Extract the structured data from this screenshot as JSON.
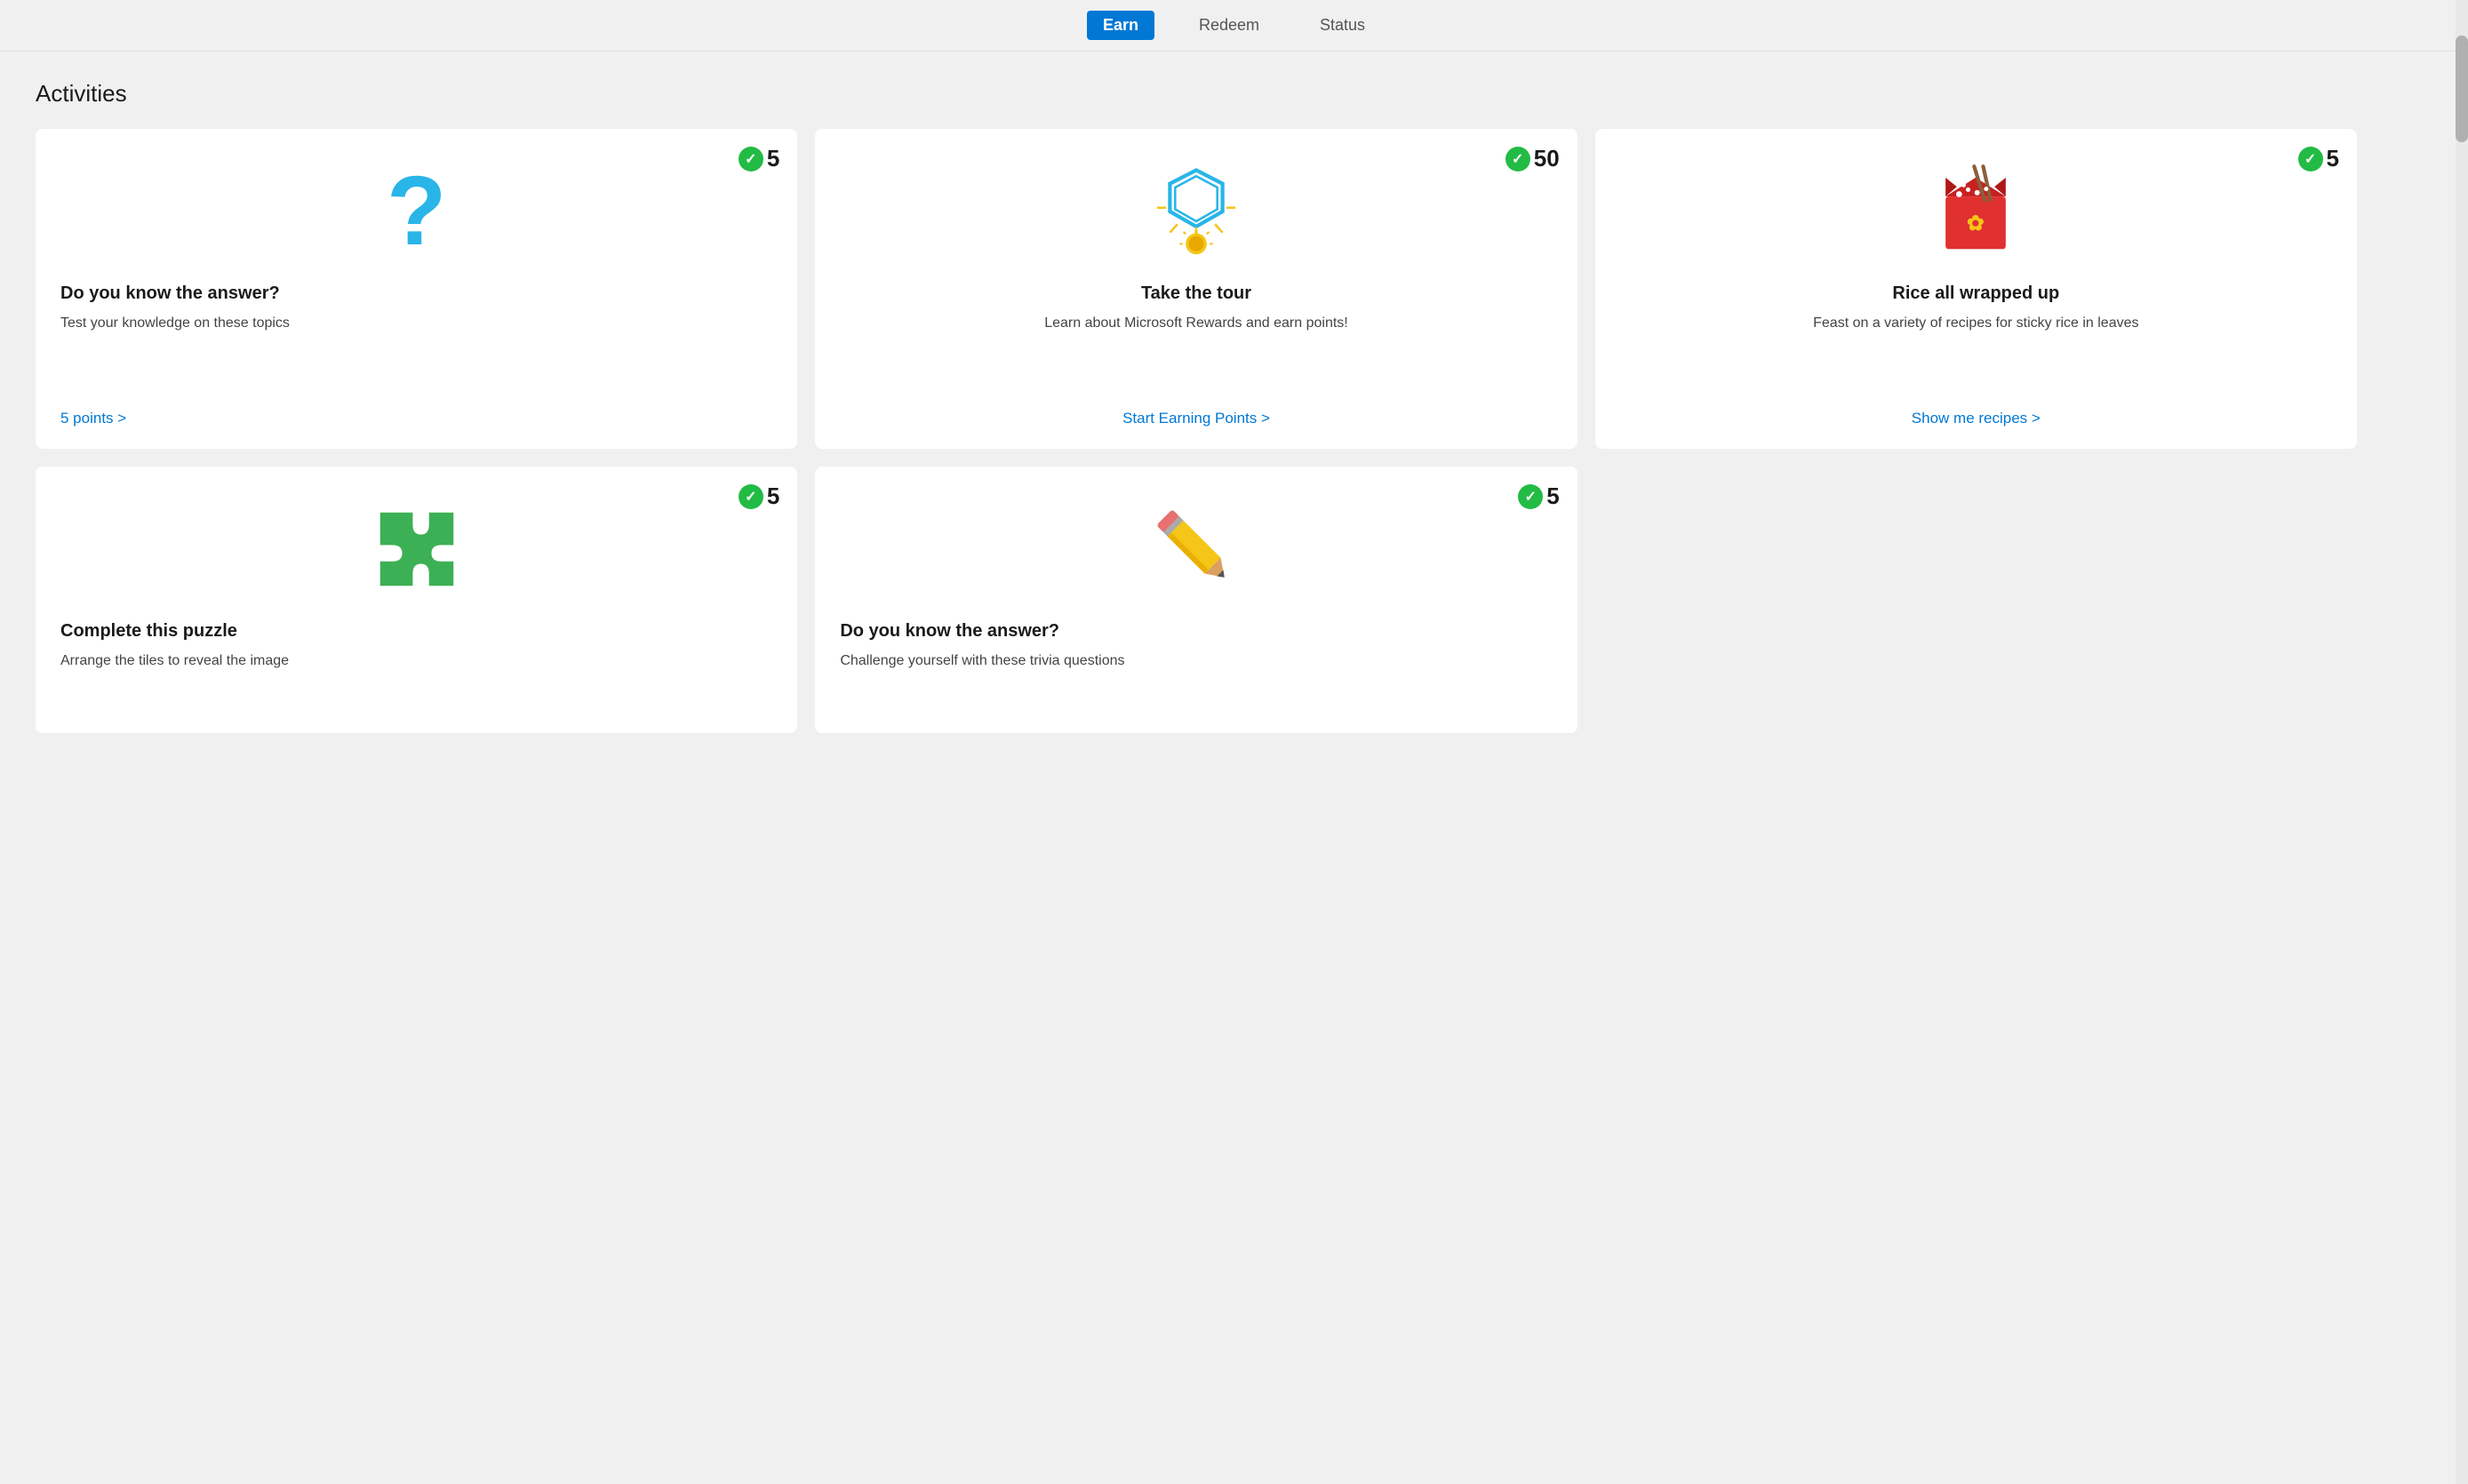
{
  "nav": {
    "tabs": [
      {
        "label": "Earn",
        "active": true
      },
      {
        "label": "Redeem",
        "active": false
      },
      {
        "label": "Status",
        "active": false
      }
    ]
  },
  "activities": {
    "title": "Activities",
    "cards": [
      {
        "id": "quiz",
        "badge_count": "5",
        "title": "Do you know the answer?",
        "desc": "Test your knowledge on these topics",
        "link": "5 points >",
        "icon_type": "question"
      },
      {
        "id": "tour",
        "badge_count": "50",
        "title": "Take the tour",
        "desc": "Learn about Microsoft Rewards and earn points!",
        "link": "Start Earning Points >",
        "icon_type": "medal"
      },
      {
        "id": "rice",
        "badge_count": "5",
        "title": "Rice all wrapped up",
        "desc": "Feast on a variety of recipes for sticky rice in leaves",
        "link": "Show me recipes >",
        "icon_type": "rice"
      },
      {
        "id": "puzzle",
        "badge_count": "5",
        "title": "Complete this puzzle",
        "desc": "Arrange the tiles to reveal the image",
        "link": "",
        "icon_type": "puzzle"
      },
      {
        "id": "trivia",
        "badge_count": "5",
        "title": "Do you know the answer?",
        "desc": "Challenge yourself with these trivia questions",
        "link": "",
        "icon_type": "pencil"
      }
    ]
  }
}
